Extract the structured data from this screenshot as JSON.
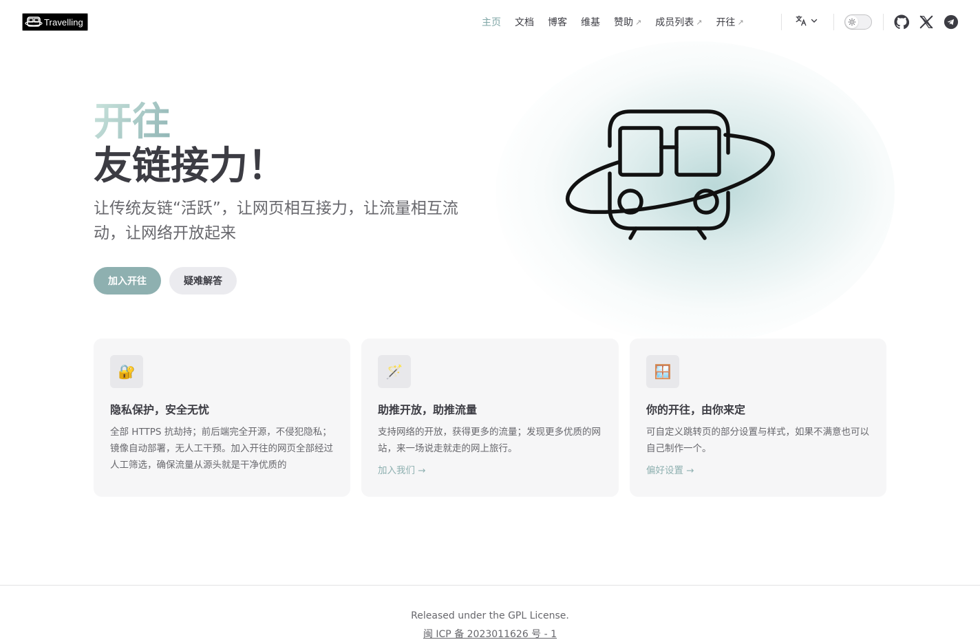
{
  "brand": {
    "logo_text": "Travelling"
  },
  "nav": {
    "items": [
      {
        "label": "主页",
        "active": true,
        "external": false
      },
      {
        "label": "文档",
        "active": false,
        "external": false
      },
      {
        "label": "博客",
        "active": false,
        "external": false
      },
      {
        "label": "维基",
        "active": false,
        "external": false
      },
      {
        "label": "赞助",
        "active": false,
        "external": true
      },
      {
        "label": "成员列表",
        "active": false,
        "external": true
      },
      {
        "label": "开往",
        "active": false,
        "external": true
      }
    ],
    "external_mark": "↗",
    "language_icon": "translate-icon",
    "theme_icon": "sun-icon",
    "social": [
      "github-icon",
      "x-icon",
      "telegram-icon"
    ]
  },
  "hero": {
    "name": "开往",
    "text": "友链接力！",
    "tagline": "让传统友链“活跃”，让网页相互接力，让流量相互流动，让网络开放起来",
    "actions": {
      "primary": "加入开往",
      "secondary": "疑难解答"
    }
  },
  "features": [
    {
      "icon": "🔐",
      "title": "隐私保护，安全无忧",
      "details": "全部 HTTPS 抗劫持；前后端完全开源，不侵犯隐私；镜像自动部署，无人工干预。加入开往的网页全部经过人工筛选，确保流量从源头就是干净优质的",
      "link": ""
    },
    {
      "icon": "🪄",
      "title": "助推开放，助推流量",
      "details": "支持网络的开放，获得更多的流量；发现更多优质的网站，来一场说走就走的网上旅行。",
      "link": "加入我们 →"
    },
    {
      "icon": "🪟",
      "title": "你的开往，由你来定",
      "details": "可自定义跳转页的部分设置与样式，如果不满意也可以自己制作一个。",
      "link": "偏好设置 →"
    }
  ],
  "footer": {
    "message": "Released under the GPL License.",
    "copyright": "闽 ICP 备 2023011626 号 - 1"
  },
  "colors": {
    "brand": "#8eb0b0",
    "text": "#3c3c43",
    "muted": "#67676c"
  }
}
